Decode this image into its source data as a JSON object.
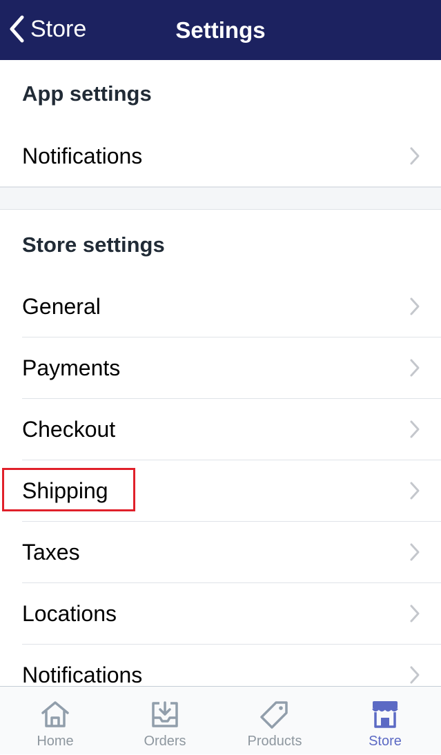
{
  "navbar": {
    "back_label": "Store",
    "title": "Settings"
  },
  "app_settings": {
    "title": "App settings",
    "items": [
      {
        "label": "Notifications"
      }
    ]
  },
  "store_settings": {
    "title": "Store settings",
    "items": [
      {
        "label": "General"
      },
      {
        "label": "Payments"
      },
      {
        "label": "Checkout"
      },
      {
        "label": "Shipping"
      },
      {
        "label": "Taxes"
      },
      {
        "label": "Locations"
      },
      {
        "label": "Notifications"
      }
    ]
  },
  "tabbar": {
    "tabs": [
      {
        "label": "Home",
        "icon": "home-icon"
      },
      {
        "label": "Orders",
        "icon": "orders-icon"
      },
      {
        "label": "Products",
        "icon": "tag-icon"
      },
      {
        "label": "Store",
        "icon": "store-icon",
        "active": true
      }
    ]
  },
  "colors": {
    "navbar_bg": "#1c2260",
    "accent": "#5c6ac4",
    "highlight_box": "#e0202a"
  }
}
